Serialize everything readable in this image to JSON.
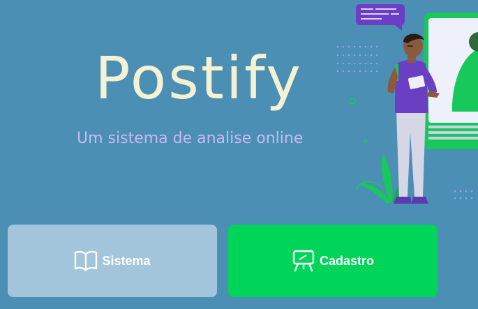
{
  "brand": {
    "title": "Postify",
    "subtitle": "Um sistema de analise online"
  },
  "buttons": {
    "sistema": {
      "label": "Sistema",
      "icon": "book-icon"
    },
    "cadastro": {
      "label": "Cadastro",
      "icon": "presentation-board-icon"
    }
  },
  "colors": {
    "background": "#4b8fb4",
    "title": "#f4f1d4",
    "subtitle": "#c9b9f3",
    "sistema_button": "#a2c5dc",
    "cadastro_button": "#00d55a",
    "accent_purple": "#6b3fc4",
    "accent_green": "#18c85a"
  },
  "illustration": {
    "description_icon": "person-with-tablet-illustration"
  }
}
